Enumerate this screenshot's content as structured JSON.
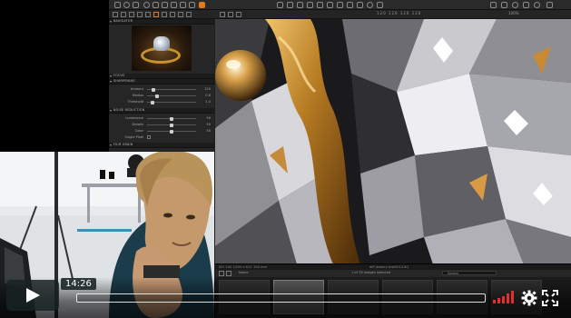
{
  "colors": {
    "accent_orange": "#e07a1f",
    "player_bg": "#172322",
    "volume_red": "#e0312c",
    "panel_bg": "#262626"
  },
  "toolbar": {
    "zoom_readout": "120 120 120 120",
    "zoom_percent": "100%"
  },
  "left_panel": {
    "navigator_title": "NAVIGATOR",
    "focus_title": "FOCUS",
    "sharpening_title": "SHARPENING",
    "sharpening_sliders": [
      {
        "label": "Amount",
        "value": "120",
        "level": 0.1
      },
      {
        "label": "Radius",
        "value": "0.8",
        "level": 0.18
      },
      {
        "label": "Threshold",
        "value": "1.0",
        "level": 0.08
      }
    ],
    "noise_title": "NOISE REDUCTION",
    "noise_sliders": [
      {
        "label": "Luminance",
        "value": "50",
        "level": 0.5
      },
      {
        "label": "Details",
        "value": "50",
        "level": 0.5
      },
      {
        "label": "Color",
        "value": "50",
        "level": 0.5
      }
    ],
    "single_pixel_label": "Single Pixel",
    "film_grain_title": "FILM GRAIN"
  },
  "viewer": {
    "status_left": "ISO 100   1/200 s   f/11   100 mm",
    "status_center": "diff jewelry test0013.IIQ"
  },
  "filmstrip": {
    "label": "Name",
    "count_text": "1 of 78 images selected",
    "search_placeholder": "Search"
  },
  "player": {
    "time": "14:26",
    "progress": 0.0,
    "volume_level": 1.0
  }
}
